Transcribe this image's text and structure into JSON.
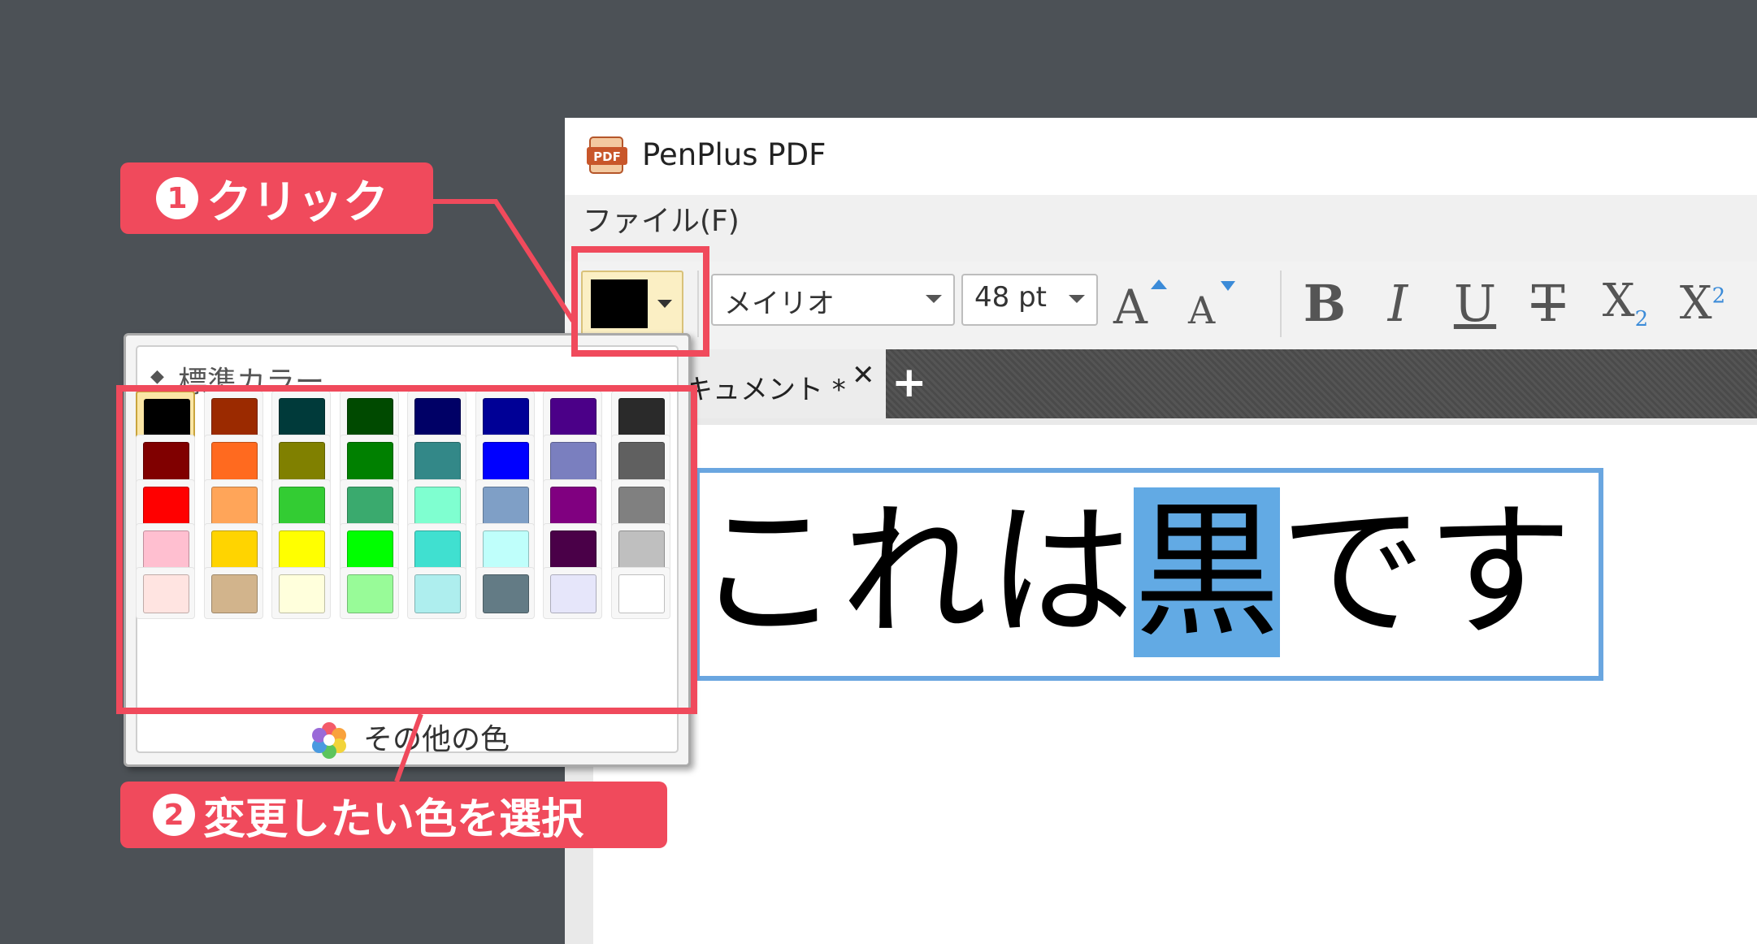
{
  "window": {
    "title": "PenPlus PDF",
    "app_icon": "pdf-app-icon",
    "app_icon_text": "PDF",
    "menu": {
      "file": "ファイル(F)"
    }
  },
  "toolbar": {
    "font_color": "#000000",
    "font_name": "メイリオ",
    "font_size": "48 pt",
    "grow_font_icon": "font-grow-icon",
    "shrink_font_icon": "font-shrink-icon",
    "bold": "B",
    "italic": "I",
    "underline": "U",
    "strike": "T",
    "subscript": "X",
    "subscript_mark": "2",
    "superscript": "X",
    "superscript_mark": "2"
  },
  "tabs": {
    "document_label": "キュメント *",
    "close": "✕",
    "add": "+"
  },
  "document": {
    "text_before": "これは",
    "text_selected": "黒",
    "text_after": "です",
    "selection_color": "#62aae4"
  },
  "palette": {
    "header": "標準カラー",
    "header_mark": "◆",
    "more_colors": "その他の色",
    "selected_index": 0,
    "colors": [
      "#000000",
      "#9b2a00",
      "#003a3a",
      "#004a00",
      "#000066",
      "#000096",
      "#4b0088",
      "#2a2a2a",
      "#800000",
      "#ff6a1f",
      "#808000",
      "#008000",
      "#338888",
      "#0000ff",
      "#7a7fbf",
      "#606060",
      "#ff0000",
      "#ffa559",
      "#33cc33",
      "#3aaa6e",
      "#7fffd0",
      "#7f9fc6",
      "#800080",
      "#808080",
      "#ffbfd0",
      "#ffd400",
      "#ffff00",
      "#00ff00",
      "#40e0d0",
      "#bffffb",
      "#4a0048",
      "#bfbfbf",
      "#ffe4e1",
      "#d2b48c",
      "#ffffdc",
      "#98fb98",
      "#aeeeee",
      "#637b85",
      "#e6e6fa",
      "#ffffff"
    ]
  },
  "callouts": {
    "step1_number": "1",
    "step1_label": "クリック",
    "step2_number": "2",
    "step2_label": "変更したい色を選択",
    "accent_color": "#f04a5c"
  }
}
